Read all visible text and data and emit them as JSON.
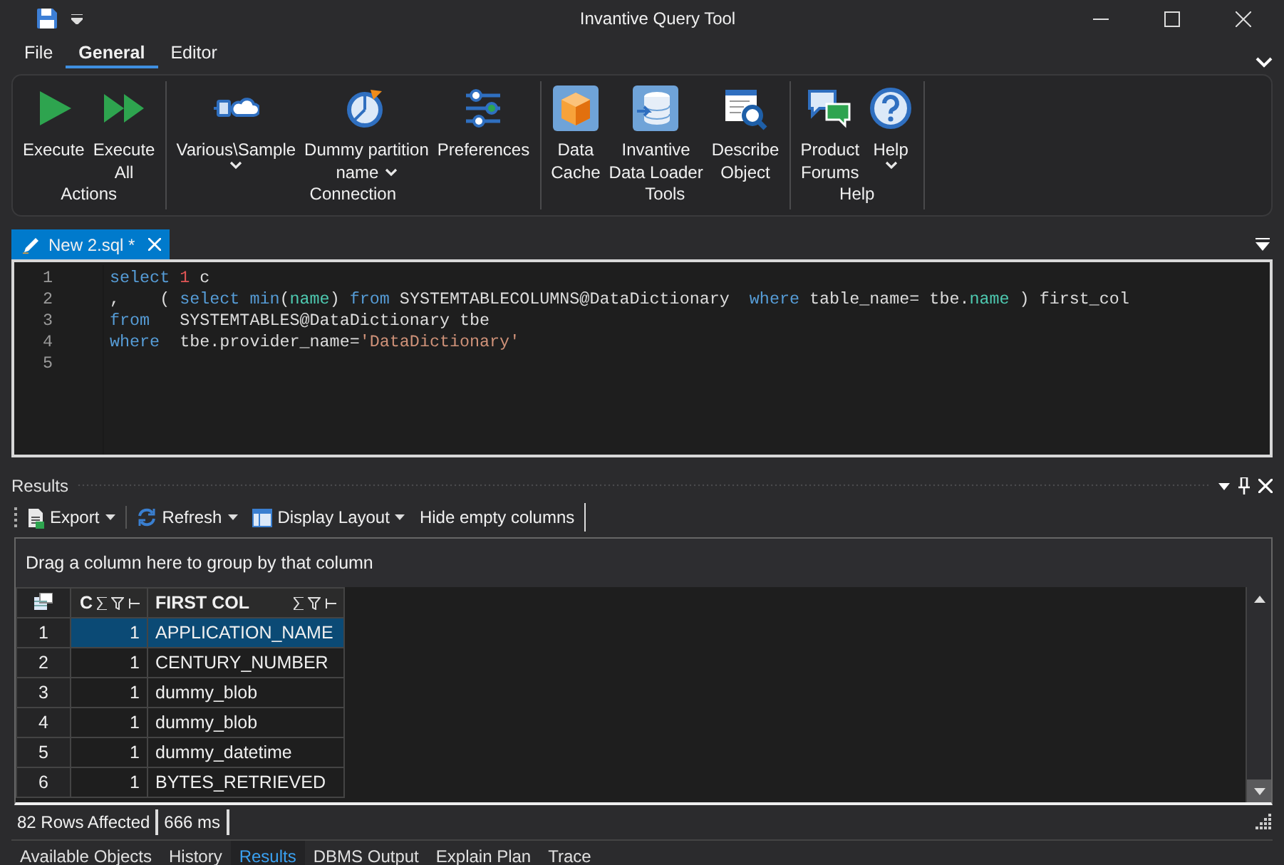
{
  "window": {
    "title": "Invantive Query Tool"
  },
  "menu_tabs": [
    {
      "label": "File",
      "selected": false
    },
    {
      "label": "General",
      "selected": true
    },
    {
      "label": "Editor",
      "selected": false
    }
  ],
  "ribbon": [
    {
      "label": "Actions",
      "buttons": [
        {
          "lines": [
            "Execute"
          ],
          "dropdown": false
        },
        {
          "lines": [
            "Execute",
            "All"
          ],
          "dropdown": false
        }
      ]
    },
    {
      "label": "Connection",
      "buttons": [
        {
          "lines": [
            "Various\\Sample"
          ],
          "dropdown": true
        },
        {
          "lines": [
            "Dummy partition",
            "name"
          ],
          "dropdown": true
        },
        {
          "lines": [
            "Preferences"
          ],
          "dropdown": false
        }
      ]
    },
    {
      "label": "Tools",
      "buttons": [
        {
          "lines": [
            "Data",
            "Cache"
          ],
          "dropdown": false
        },
        {
          "lines": [
            "Invantive",
            "Data Loader"
          ],
          "dropdown": false
        },
        {
          "lines": [
            "Describe",
            "Object"
          ],
          "dropdown": false
        }
      ]
    },
    {
      "label": "Help",
      "buttons": [
        {
          "lines": [
            "Product",
            "Forums"
          ],
          "dropdown": false
        },
        {
          "lines": [
            "Help"
          ],
          "dropdown": true
        }
      ]
    }
  ],
  "document_tabs": [
    {
      "label": "New 2.sql *",
      "selected": true
    }
  ],
  "editor": {
    "lines": [
      {
        "number": "1",
        "tokens": [
          {
            "text": "select ",
            "kind": "keyword"
          },
          {
            "text": "1",
            "kind": "number"
          },
          {
            "text": " c",
            "kind": "plain"
          }
        ]
      },
      {
        "number": "2",
        "tokens": [
          {
            "text": ",    ( ",
            "kind": "plain"
          },
          {
            "text": "select min",
            "kind": "keyword"
          },
          {
            "text": "(",
            "kind": "plain"
          },
          {
            "text": "name",
            "kind": "field"
          },
          {
            "text": ") ",
            "kind": "plain"
          },
          {
            "text": "from",
            "kind": "keyword"
          },
          {
            "text": " SYSTEMTABLECOLUMNS@DataDictionary  ",
            "kind": "plain"
          },
          {
            "text": "where",
            "kind": "keyword"
          },
          {
            "text": " table_name= tbe.",
            "kind": "plain"
          },
          {
            "text": "name",
            "kind": "field"
          },
          {
            "text": " ) first_col",
            "kind": "plain"
          }
        ]
      },
      {
        "number": "3",
        "tokens": [
          {
            "text": "from",
            "kind": "keyword"
          },
          {
            "text": "   SYSTEMTABLES@DataDictionary tbe",
            "kind": "plain"
          }
        ]
      },
      {
        "number": "4",
        "tokens": [
          {
            "text": "where",
            "kind": "keyword"
          },
          {
            "text": "  tbe.provider_name=",
            "kind": "plain"
          },
          {
            "text": "'DataDictionary'",
            "kind": "string"
          }
        ]
      },
      {
        "number": "5"
      }
    ]
  },
  "results": {
    "title": "Results",
    "toolbar": [
      {
        "label": "Export",
        "dropdown": true
      },
      {
        "label": "Refresh",
        "dropdown": true
      },
      {
        "label": "Display Layout",
        "dropdown": true
      },
      {
        "label": "Hide empty columns",
        "dropdown": false
      }
    ],
    "group_hint": "Drag a column here to group by that column",
    "columns": [
      {
        "label": "C"
      },
      {
        "label": "FIRST COL"
      }
    ],
    "rows": [
      {
        "number": "1",
        "cells": [
          "1",
          "APPLICATION_NAME"
        ],
        "selected": true
      },
      {
        "number": "2",
        "cells": [
          "1",
          "CENTURY_NUMBER"
        ],
        "selected": false
      },
      {
        "number": "3",
        "cells": [
          "1",
          "dummy_blob"
        ],
        "selected": false
      },
      {
        "number": "4",
        "cells": [
          "1",
          "dummy_blob"
        ],
        "selected": false
      },
      {
        "number": "5",
        "cells": [
          "1",
          "dummy_datetime"
        ],
        "selected": false
      },
      {
        "number": "6",
        "cells": [
          "1",
          "BYTES_RETRIEVED"
        ],
        "selected": false
      }
    ]
  },
  "status_bar": [
    "82 Rows Affected",
    "666 ms"
  ],
  "bottom_tabs": [
    {
      "label": "Available Objects",
      "selected": false
    },
    {
      "label": "History",
      "selected": false
    },
    {
      "label": "Results",
      "selected": true
    },
    {
      "label": "DBMS Output",
      "selected": false
    },
    {
      "label": "Explain Plan",
      "selected": false
    },
    {
      "label": "Trace",
      "selected": false
    }
  ]
}
